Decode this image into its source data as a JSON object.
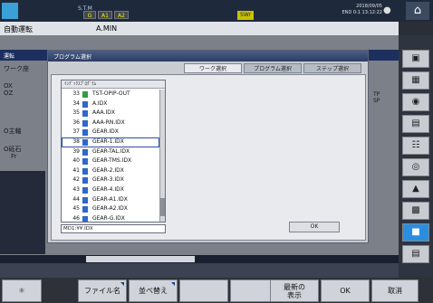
{
  "topbar": {
    "stm_label": "S.T.M",
    "boxes": [
      "G",
      "A1",
      "A2"
    ],
    "sw_label": "SWr",
    "date": "2018/09/05",
    "time": "13:12:22",
    "counter": "END 0:1"
  },
  "modeline": {
    "mode": "自動運転",
    "program": "A.MIN"
  },
  "background": {
    "tab_label": "運転",
    "work_label": "ワーク座",
    "axis_x": "OX",
    "axis_z": "OZ",
    "lbl_1": "O主軸",
    "lbl_2": "O砥石",
    "lbl_3": "Fr",
    "right_text": "TP\nSP"
  },
  "dialog": {
    "title": "プログラム選択",
    "tabs": [
      "ワーク選択",
      "プログラム選択",
      "ステップ選択"
    ],
    "active_tab": 0,
    "list_header": "ｲﾝﾃﾞｯｸｽﾌﾟﾛｸﾞﾗﾑ",
    "rows": [
      {
        "num": "33",
        "name": "TST-OPIP-OUT",
        "icon": "green"
      },
      {
        "num": "34",
        "name": "A.IDX",
        "icon": "blue"
      },
      {
        "num": "35",
        "name": "AAA.IDX",
        "icon": "blue"
      },
      {
        "num": "36",
        "name": "AAA-RN.IDX",
        "icon": "blue"
      },
      {
        "num": "37",
        "name": "GEAR.IDX",
        "icon": "blue"
      },
      {
        "num": "38",
        "name": "GEAR-1.IDX",
        "icon": "blue",
        "selected": true
      },
      {
        "num": "39",
        "name": "GEAR-TAL.IDX",
        "icon": "blue"
      },
      {
        "num": "40",
        "name": "GEAR-TMS.IDX",
        "icon": "blue"
      },
      {
        "num": "41",
        "name": "GEAR-2.IDX",
        "icon": "blue"
      },
      {
        "num": "42",
        "name": "GEAR-3.IDX",
        "icon": "blue"
      },
      {
        "num": "43",
        "name": "GEAR-4.IDX",
        "icon": "blue"
      },
      {
        "num": "44",
        "name": "GEAR-A1.IDX",
        "icon": "blue"
      },
      {
        "num": "45",
        "name": "GEAR-A2.IDX",
        "icon": "blue"
      },
      {
        "num": "46",
        "name": "GEAR-G.IDX",
        "icon": "blue"
      }
    ],
    "path_text": "MD1:¥¥.IDX",
    "ok_label": "OK"
  },
  "softkeys": [
    "ファイル名",
    "並べ替え",
    "",
    "",
    "最新の\n表示",
    "OK",
    "取消"
  ],
  "colors": {
    "accent": "#2a8ee0",
    "folder": "#2d69c8",
    "folder_alt": "#2fa040",
    "title_bar": "#2c3d64"
  }
}
